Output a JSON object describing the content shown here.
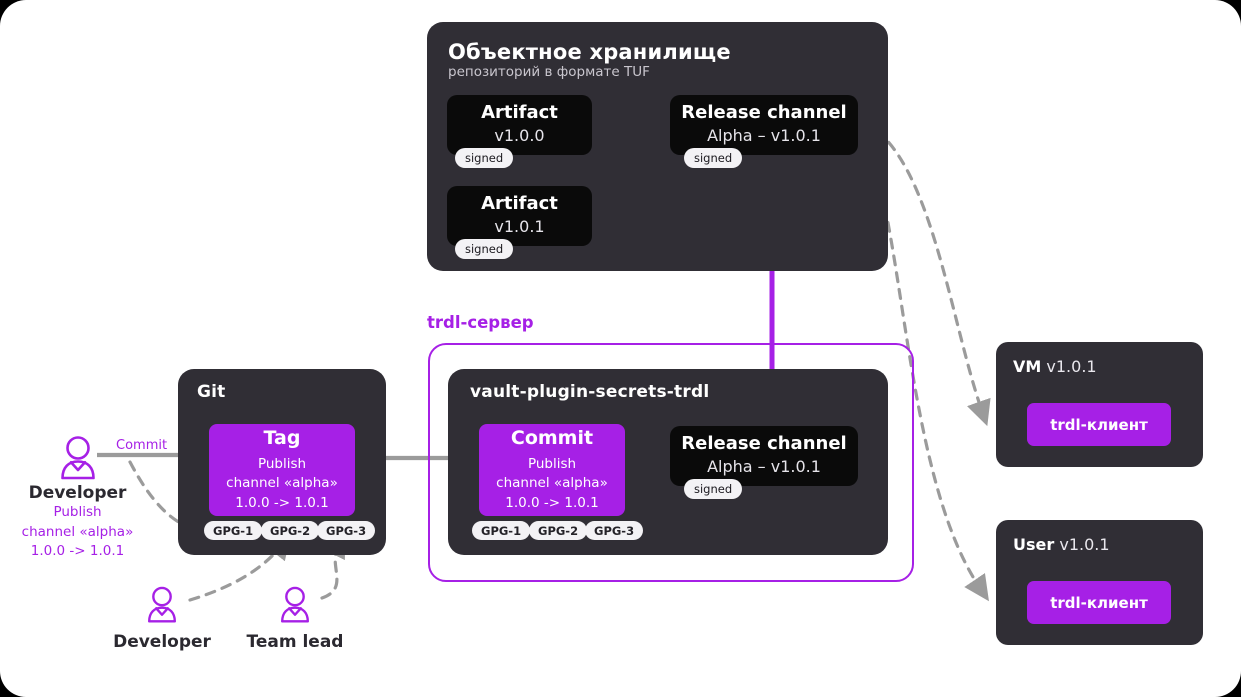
{
  "colors": {
    "accent": "#A620E6",
    "panel": "#302E35",
    "box": "#0a0a0a",
    "arrow_gray": "#9b9b9b",
    "background": "#ffffff"
  },
  "storage": {
    "title": "Объектное хранилище",
    "subtitle": "репозиторий в формате TUF",
    "artifacts": [
      {
        "title": "Artifact",
        "version": "v1.0.0",
        "badge": "signed"
      },
      {
        "title": "Artifact",
        "version": "v1.0.1",
        "badge": "signed"
      }
    ],
    "release_channel": {
      "title": "Release channel",
      "subtitle": "Alpha – v1.0.1",
      "badge": "signed"
    }
  },
  "git": {
    "title": "Git",
    "tag": {
      "title": "Tag",
      "line1": "Publish",
      "line2": "channel «alpha»",
      "line3": "1.0.0 -> 1.0.1"
    },
    "gpg_badges": [
      "GPG-1",
      "GPG-2",
      "GPG-3"
    ]
  },
  "trdl_server": {
    "label": "trdl-сервер",
    "plugin_title": "vault-plugin-secrets-trdl",
    "commit": {
      "title": "Commit",
      "line1": "Publish",
      "line2": "channel «alpha»",
      "line3": "1.0.0 -> 1.0.1"
    },
    "gpg_badges": [
      "GPG-1",
      "GPG-2",
      "GPG-3"
    ],
    "release_channel": {
      "title": "Release channel",
      "subtitle": "Alpha – v1.0.1",
      "badge": "signed"
    }
  },
  "clients": [
    {
      "name": "VM",
      "version": "v1.0.1",
      "button": "trdl-клиент"
    },
    {
      "name": "User",
      "version": "v1.0.1",
      "button": "trdl-клиент"
    }
  ],
  "actors": {
    "developer_main": {
      "name": "Developer",
      "note_line1": "Publish",
      "note_line2": "channel «alpha»",
      "note_line3": "1.0.0 -> 1.0.1",
      "icon": "person-icon"
    },
    "developer_bottom": {
      "name": "Developer",
      "icon": "person-icon"
    },
    "team_lead": {
      "name": "Team lead",
      "icon": "person-icon"
    }
  },
  "edges": {
    "commit_label": "Commit"
  }
}
